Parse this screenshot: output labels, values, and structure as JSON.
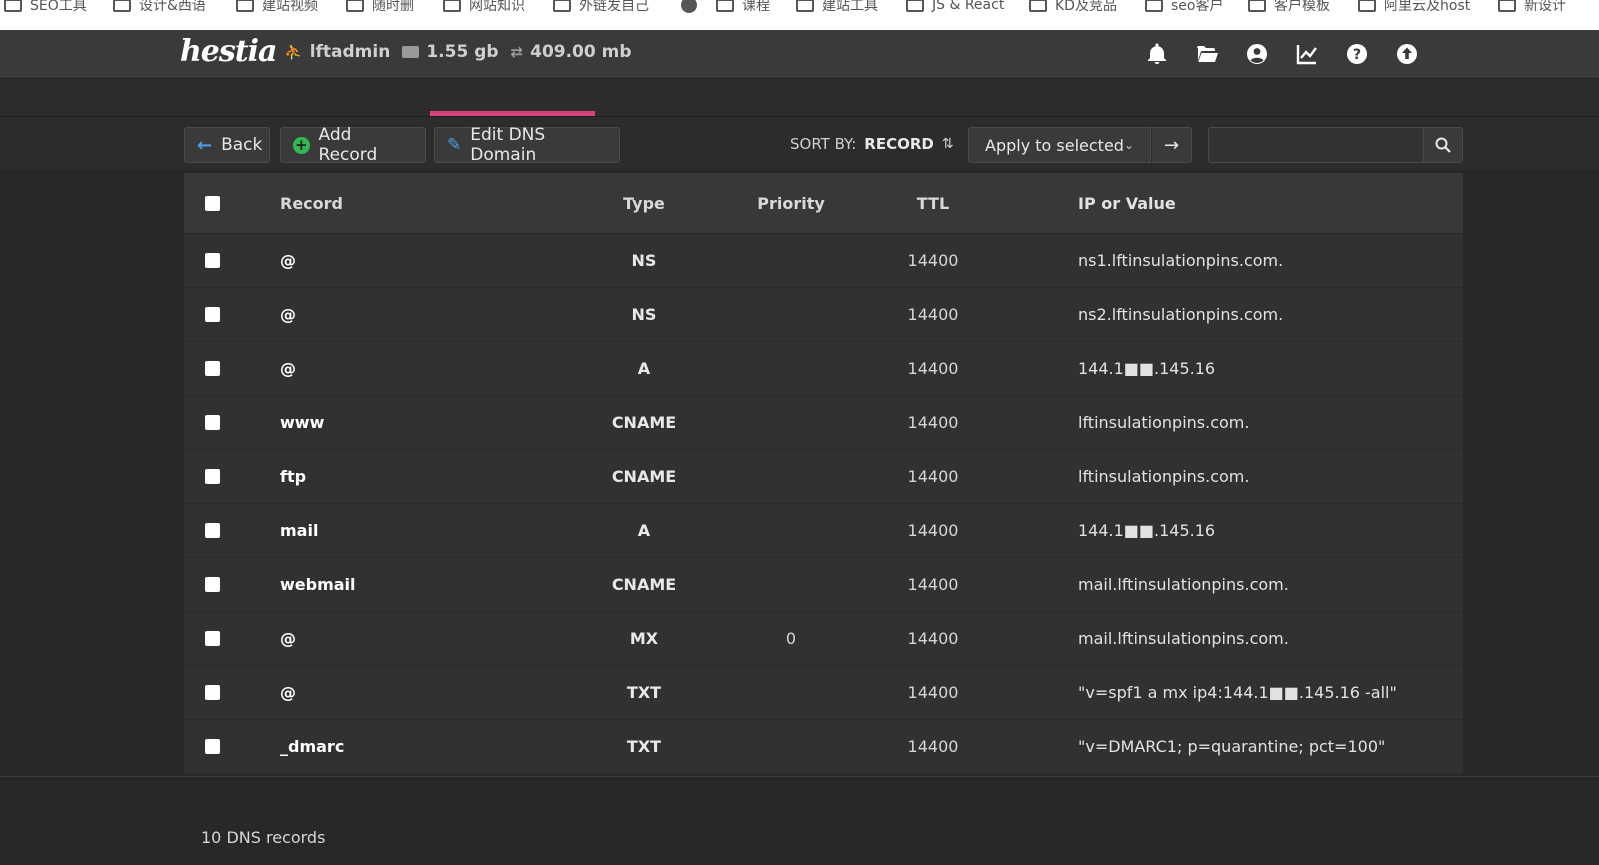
{
  "bookmarks": [
    {
      "label": "SEO工具",
      "icon": "folder-icon"
    },
    {
      "label": "设计&西语",
      "icon": "folder-icon"
    },
    {
      "label": "建站视频",
      "icon": "folder-icon"
    },
    {
      "label": "随时删",
      "icon": "folder-icon"
    },
    {
      "label": "网站知识",
      "icon": "folder-icon"
    },
    {
      "label": "外链发自己",
      "icon": "folder-icon"
    },
    {
      "label": "",
      "icon": "globe-icon"
    },
    {
      "label": "课程",
      "icon": "folder-icon"
    },
    {
      "label": "建站工具",
      "icon": "folder-icon"
    },
    {
      "label": "JS & React",
      "icon": "folder-icon"
    },
    {
      "label": "KD及竞品",
      "icon": "folder-icon"
    },
    {
      "label": "seo客户",
      "icon": "folder-icon"
    },
    {
      "label": "客户模板",
      "icon": "folder-icon"
    },
    {
      "label": "阿里云及host",
      "icon": "folder-icon"
    },
    {
      "label": "新设计",
      "icon": "folder-icon"
    }
  ],
  "header": {
    "logo": "hestia",
    "user": "lftadmin",
    "disk": "1.55 gb",
    "bandwidth": "409.00 mb",
    "icons": [
      "bell-icon",
      "folder-open-icon",
      "user-circle-icon",
      "chart-line-icon",
      "help-icon",
      "upload-icon"
    ]
  },
  "toolbar": {
    "back_label": "Back",
    "add_label": "Add Record",
    "edit_label": "Edit DNS Domain",
    "sort_label": "SORT BY:",
    "sort_value": "RECORD",
    "apply_label": "Apply to selected",
    "search_placeholder": ""
  },
  "table": {
    "headers": {
      "record": "Record",
      "type": "Type",
      "priority": "Priority",
      "ttl": "TTL",
      "value": "IP or Value"
    },
    "rows": [
      {
        "record": "@",
        "type": "NS",
        "priority": "",
        "ttl": "14400",
        "value": "ns1.lftinsulationpins.com."
      },
      {
        "record": "@",
        "type": "NS",
        "priority": "",
        "ttl": "14400",
        "value": "ns2.lftinsulationpins.com."
      },
      {
        "record": "@",
        "type": "A",
        "priority": "",
        "ttl": "14400",
        "value": "144.1■■.145.16"
      },
      {
        "record": "www",
        "type": "CNAME",
        "priority": "",
        "ttl": "14400",
        "value": "lftinsulationpins.com."
      },
      {
        "record": "ftp",
        "type": "CNAME",
        "priority": "",
        "ttl": "14400",
        "value": "lftinsulationpins.com."
      },
      {
        "record": "mail",
        "type": "A",
        "priority": "",
        "ttl": "14400",
        "value": "144.1■■.145.16"
      },
      {
        "record": "webmail",
        "type": "CNAME",
        "priority": "",
        "ttl": "14400",
        "value": "mail.lftinsulationpins.com."
      },
      {
        "record": "@",
        "type": "MX",
        "priority": "0",
        "ttl": "14400",
        "value": "mail.lftinsulationpins.com."
      },
      {
        "record": "@",
        "type": "TXT",
        "priority": "",
        "ttl": "14400",
        "value": "\"v=spf1 a mx ip4:144.1■■.145.16 -all\""
      },
      {
        "record": "_dmarc",
        "type": "TXT",
        "priority": "",
        "ttl": "14400",
        "value": "\"v=DMARC1; p=quarantine; pct=100\""
      }
    ]
  },
  "footer": {
    "count_text": "10 DNS records"
  },
  "colors": {
    "accent": "#d8427b",
    "add_green": "#32b853",
    "link_blue": "#4a9ee8"
  }
}
